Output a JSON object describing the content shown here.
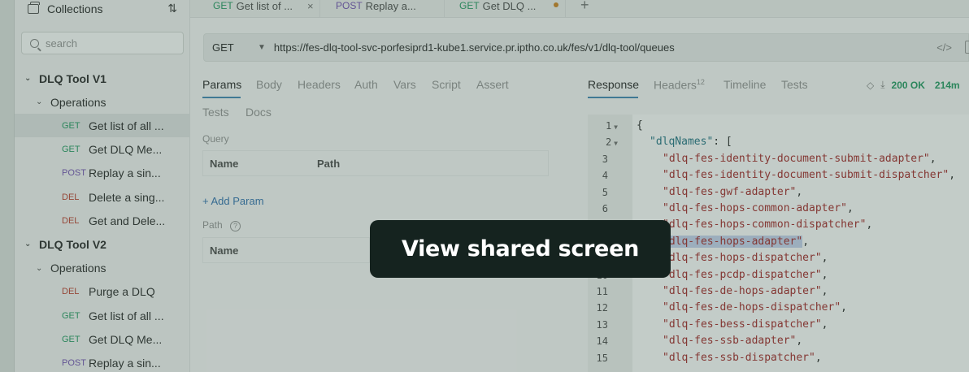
{
  "sidebar": {
    "title": "Collections",
    "search_placeholder": "search",
    "tree": [
      {
        "kind": "group",
        "label": "DLQ Tool V1"
      },
      {
        "kind": "sub",
        "label": "Operations"
      },
      {
        "kind": "item",
        "method": "GET",
        "label": "Get list of all ...",
        "active": true
      },
      {
        "kind": "item",
        "method": "GET",
        "label": "Get DLQ Me..."
      },
      {
        "kind": "item",
        "method": "POST",
        "label": "Replay a sin..."
      },
      {
        "kind": "item",
        "method": "DEL",
        "label": "Delete a sing..."
      },
      {
        "kind": "item",
        "method": "DEL",
        "label": "Get and Dele..."
      },
      {
        "kind": "group",
        "label": "DLQ Tool V2"
      },
      {
        "kind": "sub",
        "label": "Operations"
      },
      {
        "kind": "item",
        "method": "DEL",
        "label": "Purge a DLQ"
      },
      {
        "kind": "item",
        "method": "GET",
        "label": "Get list of all ..."
      },
      {
        "kind": "item",
        "method": "GET",
        "label": "Get DLQ Me..."
      },
      {
        "kind": "item",
        "method": "POST",
        "label": "Replay a sin..."
      }
    ]
  },
  "tabs": [
    {
      "method": "GET",
      "label": "Get list of ...",
      "close": "×"
    },
    {
      "method": "POST",
      "label": "Replay a..."
    },
    {
      "method": "GET",
      "label": "Get DLQ ..."
    }
  ],
  "tab_add": "+",
  "request": {
    "method": "GET",
    "url": "https://fes-dlq-tool-svc-porfesiprd1-kube1.service.pr.iptho.co.uk/fes/v1/dlq-tool/queues",
    "tabs_row1": [
      "Params",
      "Body",
      "Headers",
      "Auth",
      "Vars",
      "Script",
      "Assert"
    ],
    "tabs_row2": [
      "Tests",
      "Docs"
    ],
    "query_label": "Query",
    "query_cols": [
      "Name",
      "Path"
    ],
    "add_param": "+ Add Param",
    "path_label": "Path",
    "path_cols": [
      "Name"
    ]
  },
  "response": {
    "tabs": [
      "Response",
      "Headers",
      "Timeline",
      "Tests"
    ],
    "headers_count": "12",
    "status": "200 OK",
    "time": "214m",
    "lines": [
      {
        "n": "1",
        "fold": true,
        "text": "{"
      },
      {
        "n": "2",
        "fold": true,
        "key": "\"dlqNames\"",
        "text": ": ["
      },
      {
        "n": "3",
        "str": "\"dlq-fes-identity-document-submit-adapter\"",
        "tail": ","
      },
      {
        "n": "4",
        "str": "\"dlq-fes-identity-document-submit-dispatcher\"",
        "tail": ","
      },
      {
        "n": "5",
        "str": "\"dlq-fes-gwf-adapter\"",
        "tail": ","
      },
      {
        "n": "6",
        "str": "\"dlq-fes-hops-common-adapter\"",
        "tail": ","
      },
      {
        "n": "7",
        "str": "\"dlq-fes-hops-common-dispatcher\"",
        "tail": ","
      },
      {
        "n": "8",
        "str": "\"dlq-fes-hops-adapter\"",
        "tail": ",",
        "highlight": true
      },
      {
        "n": "9",
        "str": "\"dlq-fes-hops-dispatcher\"",
        "tail": ","
      },
      {
        "n": "10",
        "str": "\"dlq-fes-pcdp-dispatcher\"",
        "tail": ","
      },
      {
        "n": "11",
        "str": "\"dlq-fes-de-hops-adapter\"",
        "tail": ","
      },
      {
        "n": "12",
        "str": "\"dlq-fes-de-hops-dispatcher\"",
        "tail": ","
      },
      {
        "n": "13",
        "str": "\"dlq-fes-bess-dispatcher\"",
        "tail": ","
      },
      {
        "n": "14",
        "str": "\"dlq-fes-ssb-adapter\"",
        "tail": ","
      },
      {
        "n": "15",
        "str": "\"dlq-fes-ssb-dispatcher\"",
        "tail": ","
      }
    ]
  },
  "overlay": {
    "label": "View shared screen"
  },
  "colors": {
    "get": "#2e9e6a",
    "post": "#7b5ab8",
    "del": "#c0493a",
    "accent": "#4a8db7",
    "pill_bg": "#15231f"
  }
}
